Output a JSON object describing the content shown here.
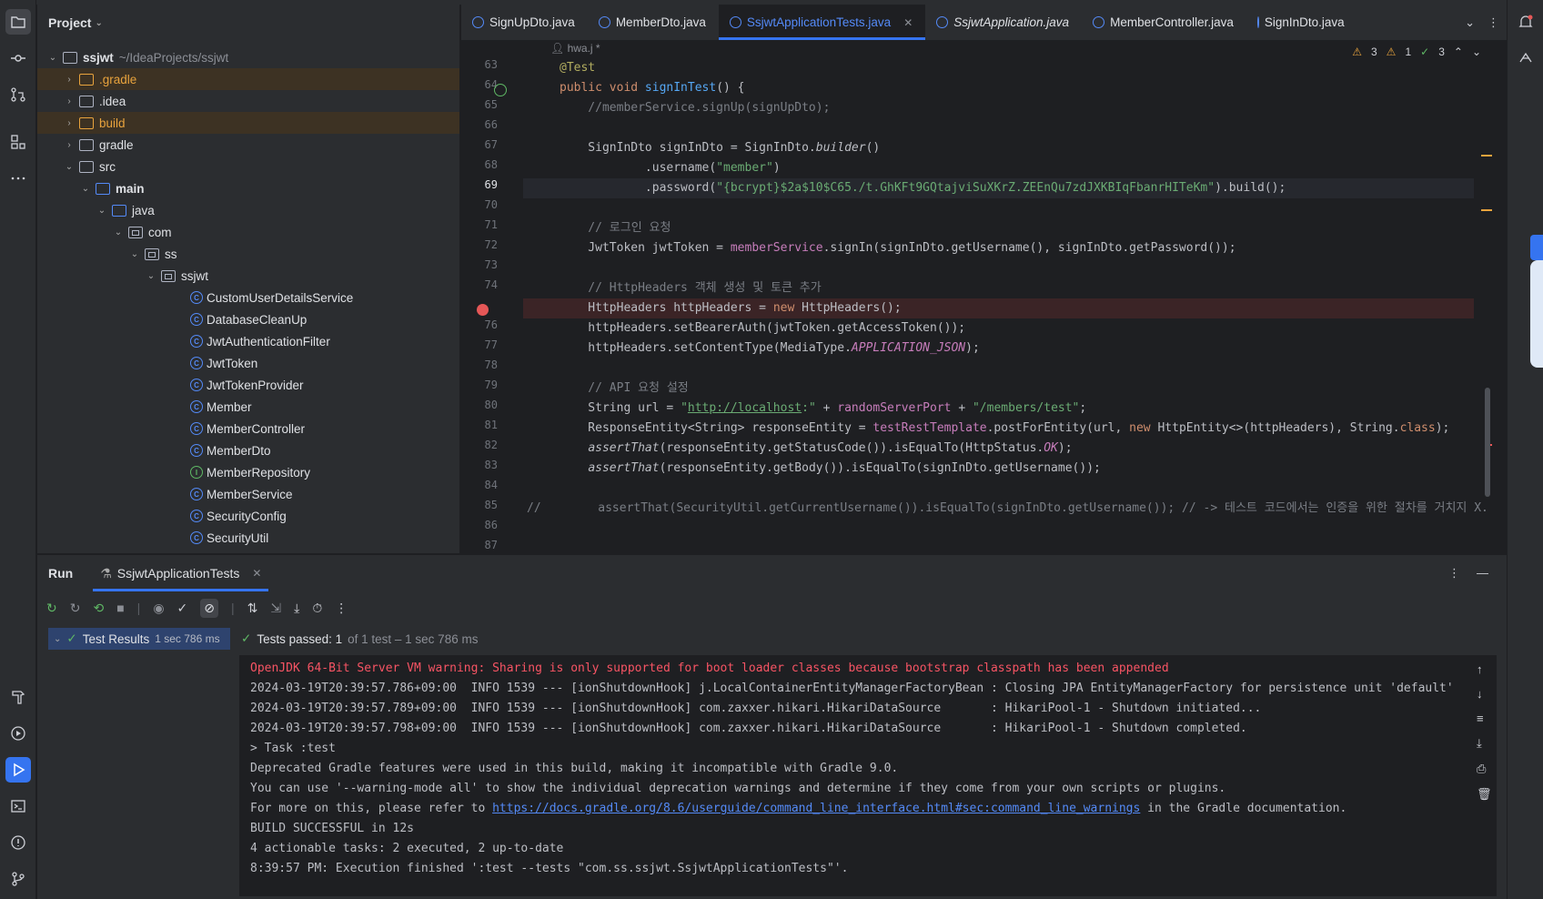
{
  "project_panel": {
    "title": "Project",
    "tree": [
      {
        "label": "ssjwt",
        "path": "~/IdeaProjects/ssjwt",
        "type": "module",
        "bold": true
      },
      {
        "label": ".gradle",
        "type": "folder",
        "excluded": true
      },
      {
        "label": ".idea",
        "type": "folder"
      },
      {
        "label": "build",
        "type": "folder",
        "excluded": true
      },
      {
        "label": "gradle",
        "type": "folder"
      },
      {
        "label": "src",
        "type": "folder"
      },
      {
        "label": "main",
        "type": "folder",
        "bold": true
      },
      {
        "label": "java",
        "type": "folder"
      },
      {
        "label": "com",
        "type": "package"
      },
      {
        "label": "ss",
        "type": "package"
      },
      {
        "label": "ssjwt",
        "type": "package"
      },
      {
        "label": "CustomUserDetailsService",
        "type": "class"
      },
      {
        "label": "DatabaseCleanUp",
        "type": "class"
      },
      {
        "label": "JwtAuthenticationFilter",
        "type": "class"
      },
      {
        "label": "JwtToken",
        "type": "class"
      },
      {
        "label": "JwtTokenProvider",
        "type": "class"
      },
      {
        "label": "Member",
        "type": "class"
      },
      {
        "label": "MemberController",
        "type": "class"
      },
      {
        "label": "MemberDto",
        "type": "class"
      },
      {
        "label": "MemberRepository",
        "type": "interface"
      },
      {
        "label": "MemberService",
        "type": "class"
      },
      {
        "label": "SecurityConfig",
        "type": "class"
      },
      {
        "label": "SecurityUtil",
        "type": "class"
      }
    ]
  },
  "editor_tabs": [
    {
      "label": "SignUpDto.java"
    },
    {
      "label": "MemberDto.java"
    },
    {
      "label": "SsjwtApplicationTests.java",
      "active": true
    },
    {
      "label": "SsjwtApplication.java"
    },
    {
      "label": "MemberController.java"
    },
    {
      "label": "SignInDto.java"
    }
  ],
  "editor": {
    "author": "hwa.j *",
    "inspections": {
      "warnings": "3",
      "weak_warnings": "1",
      "ok": "3"
    },
    "current_line": "69",
    "breakpoint_line": "75"
  },
  "run_panel": {
    "title": "Run",
    "tab_label": "SsjwtApplicationTests",
    "results_label": "Test Results",
    "results_time": "1 sec 786 ms",
    "status_passed": "Tests passed: 1",
    "status_detail": "of 1 test – 1 sec 786 ms",
    "console_lines": [
      {
        "text": "OpenJDK 64-Bit Server VM warning: Sharing is only supported for boot loader classes because bootstrap classpath has been appended",
        "kind": "err"
      },
      {
        "text": "2024-03-19T20:39:57.786+09:00  INFO 1539 --- [ionShutdownHook] j.LocalContainerEntityManagerFactoryBean : Closing JPA EntityManagerFactory for persistence unit 'default'",
        "kind": "info"
      },
      {
        "text": "2024-03-19T20:39:57.789+09:00  INFO 1539 --- [ionShutdownHook] com.zaxxer.hikari.HikariDataSource       : HikariPool-1 - Shutdown initiated...",
        "kind": "info"
      },
      {
        "text": "2024-03-19T20:39:57.798+09:00  INFO 1539 --- [ionShutdownHook] com.zaxxer.hikari.HikariDataSource       : HikariPool-1 - Shutdown completed.",
        "kind": "info"
      },
      {
        "text": "> Task :test",
        "kind": "info"
      },
      {
        "text": "Deprecated Gradle features were used in this build, making it incompatible with Gradle 9.0.",
        "kind": "info"
      },
      {
        "text": "You can use '--warning-mode all' to show the individual deprecation warnings and determine if they come from your own scripts or plugins.",
        "kind": "info"
      },
      {
        "text": "BUILD SUCCESSFUL in 12s",
        "kind": "info"
      },
      {
        "text": "4 actionable tasks: 2 executed, 2 up-to-date",
        "kind": "info"
      },
      {
        "text": "8:39:57 PM: Execution finished ':test --tests \"com.ss.ssjwt.SsjwtApplicationTests\"'.",
        "kind": "info"
      }
    ],
    "docs_line": {
      "prefix": "For more on this, please refer to ",
      "link": "https://docs.gradle.org/8.6/userguide/command_line_interface.html#sec:command_line_warnings",
      "suffix": " in the Gradle documentation."
    }
  },
  "colors": {
    "accent": "#3574f0",
    "error": "#f75464",
    "pass": "#5fb865",
    "excluded_folder": "#e8a33d"
  }
}
